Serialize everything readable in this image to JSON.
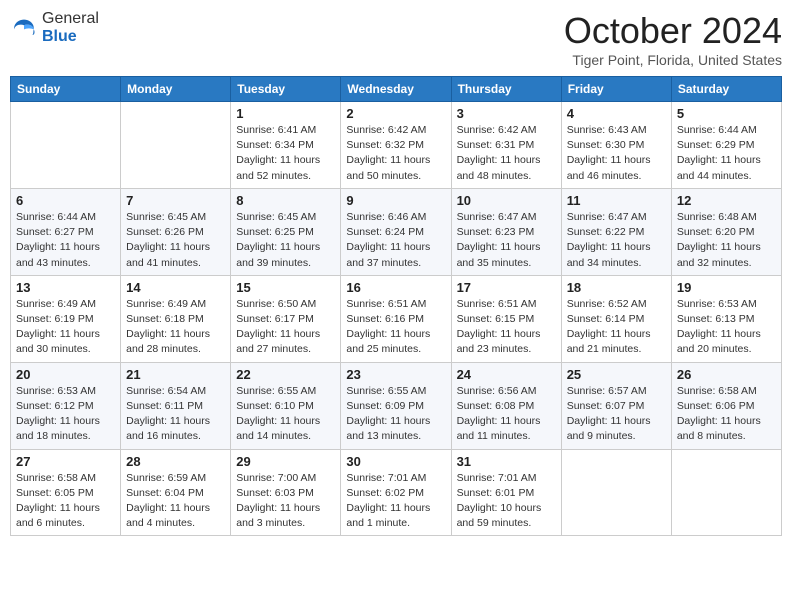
{
  "header": {
    "logo_general": "General",
    "logo_blue": "Blue",
    "month_year": "October 2024",
    "location": "Tiger Point, Florida, United States"
  },
  "calendar": {
    "days_of_week": [
      "Sunday",
      "Monday",
      "Tuesday",
      "Wednesday",
      "Thursday",
      "Friday",
      "Saturday"
    ],
    "weeks": [
      [
        {
          "day": "",
          "info": ""
        },
        {
          "day": "",
          "info": ""
        },
        {
          "day": "1",
          "info": "Sunrise: 6:41 AM\nSunset: 6:34 PM\nDaylight: 11 hours and 52 minutes."
        },
        {
          "day": "2",
          "info": "Sunrise: 6:42 AM\nSunset: 6:32 PM\nDaylight: 11 hours and 50 minutes."
        },
        {
          "day": "3",
          "info": "Sunrise: 6:42 AM\nSunset: 6:31 PM\nDaylight: 11 hours and 48 minutes."
        },
        {
          "day": "4",
          "info": "Sunrise: 6:43 AM\nSunset: 6:30 PM\nDaylight: 11 hours and 46 minutes."
        },
        {
          "day": "5",
          "info": "Sunrise: 6:44 AM\nSunset: 6:29 PM\nDaylight: 11 hours and 44 minutes."
        }
      ],
      [
        {
          "day": "6",
          "info": "Sunrise: 6:44 AM\nSunset: 6:27 PM\nDaylight: 11 hours and 43 minutes."
        },
        {
          "day": "7",
          "info": "Sunrise: 6:45 AM\nSunset: 6:26 PM\nDaylight: 11 hours and 41 minutes."
        },
        {
          "day": "8",
          "info": "Sunrise: 6:45 AM\nSunset: 6:25 PM\nDaylight: 11 hours and 39 minutes."
        },
        {
          "day": "9",
          "info": "Sunrise: 6:46 AM\nSunset: 6:24 PM\nDaylight: 11 hours and 37 minutes."
        },
        {
          "day": "10",
          "info": "Sunrise: 6:47 AM\nSunset: 6:23 PM\nDaylight: 11 hours and 35 minutes."
        },
        {
          "day": "11",
          "info": "Sunrise: 6:47 AM\nSunset: 6:22 PM\nDaylight: 11 hours and 34 minutes."
        },
        {
          "day": "12",
          "info": "Sunrise: 6:48 AM\nSunset: 6:20 PM\nDaylight: 11 hours and 32 minutes."
        }
      ],
      [
        {
          "day": "13",
          "info": "Sunrise: 6:49 AM\nSunset: 6:19 PM\nDaylight: 11 hours and 30 minutes."
        },
        {
          "day": "14",
          "info": "Sunrise: 6:49 AM\nSunset: 6:18 PM\nDaylight: 11 hours and 28 minutes."
        },
        {
          "day": "15",
          "info": "Sunrise: 6:50 AM\nSunset: 6:17 PM\nDaylight: 11 hours and 27 minutes."
        },
        {
          "day": "16",
          "info": "Sunrise: 6:51 AM\nSunset: 6:16 PM\nDaylight: 11 hours and 25 minutes."
        },
        {
          "day": "17",
          "info": "Sunrise: 6:51 AM\nSunset: 6:15 PM\nDaylight: 11 hours and 23 minutes."
        },
        {
          "day": "18",
          "info": "Sunrise: 6:52 AM\nSunset: 6:14 PM\nDaylight: 11 hours and 21 minutes."
        },
        {
          "day": "19",
          "info": "Sunrise: 6:53 AM\nSunset: 6:13 PM\nDaylight: 11 hours and 20 minutes."
        }
      ],
      [
        {
          "day": "20",
          "info": "Sunrise: 6:53 AM\nSunset: 6:12 PM\nDaylight: 11 hours and 18 minutes."
        },
        {
          "day": "21",
          "info": "Sunrise: 6:54 AM\nSunset: 6:11 PM\nDaylight: 11 hours and 16 minutes."
        },
        {
          "day": "22",
          "info": "Sunrise: 6:55 AM\nSunset: 6:10 PM\nDaylight: 11 hours and 14 minutes."
        },
        {
          "day": "23",
          "info": "Sunrise: 6:55 AM\nSunset: 6:09 PM\nDaylight: 11 hours and 13 minutes."
        },
        {
          "day": "24",
          "info": "Sunrise: 6:56 AM\nSunset: 6:08 PM\nDaylight: 11 hours and 11 minutes."
        },
        {
          "day": "25",
          "info": "Sunrise: 6:57 AM\nSunset: 6:07 PM\nDaylight: 11 hours and 9 minutes."
        },
        {
          "day": "26",
          "info": "Sunrise: 6:58 AM\nSunset: 6:06 PM\nDaylight: 11 hours and 8 minutes."
        }
      ],
      [
        {
          "day": "27",
          "info": "Sunrise: 6:58 AM\nSunset: 6:05 PM\nDaylight: 11 hours and 6 minutes."
        },
        {
          "day": "28",
          "info": "Sunrise: 6:59 AM\nSunset: 6:04 PM\nDaylight: 11 hours and 4 minutes."
        },
        {
          "day": "29",
          "info": "Sunrise: 7:00 AM\nSunset: 6:03 PM\nDaylight: 11 hours and 3 minutes."
        },
        {
          "day": "30",
          "info": "Sunrise: 7:01 AM\nSunset: 6:02 PM\nDaylight: 11 hours and 1 minute."
        },
        {
          "day": "31",
          "info": "Sunrise: 7:01 AM\nSunset: 6:01 PM\nDaylight: 10 hours and 59 minutes."
        },
        {
          "day": "",
          "info": ""
        },
        {
          "day": "",
          "info": ""
        }
      ]
    ]
  }
}
